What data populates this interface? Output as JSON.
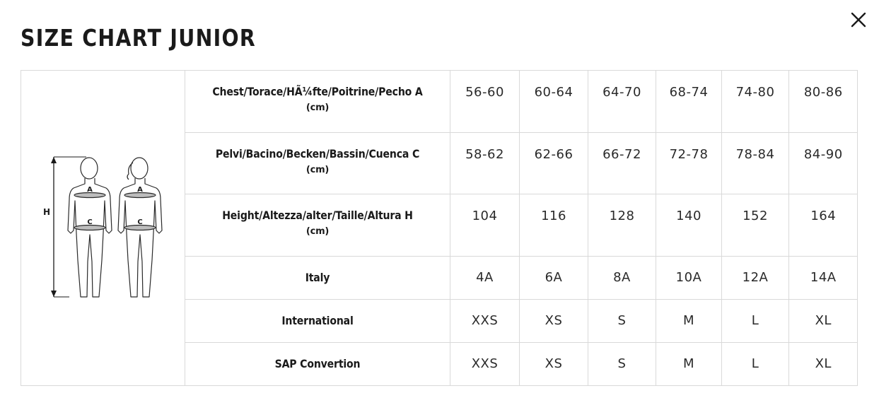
{
  "title": "SIZE CHART JUNIOR",
  "close_icon": "close-icon",
  "figure": {
    "height_label": "H",
    "chest_label": "A",
    "pelvis_label": "C"
  },
  "rows": [
    {
      "label": "Chest/Torace/HÃ¼fte/Poitrine/Pecho A",
      "unit": "(cm)",
      "values": [
        "56-60",
        "60-64",
        "64-70",
        "68-74",
        "74-80",
        "80-86"
      ]
    },
    {
      "label": "Pelvi/Bacino/Becken/Bassin/Cuenca C",
      "unit": "(cm)",
      "values": [
        "58-62",
        "62-66",
        "66-72",
        "72-78",
        "78-84",
        "84-90"
      ]
    },
    {
      "label": "Height/Altezza/alter/Taille/Altura H",
      "unit": "(cm)",
      "values": [
        "104",
        "116",
        "128",
        "140",
        "152",
        "164"
      ]
    },
    {
      "label": "Italy",
      "unit": "",
      "values": [
        "4A",
        "6A",
        "8A",
        "10A",
        "12A",
        "14A"
      ]
    },
    {
      "label": "International",
      "unit": "",
      "values": [
        "XXS",
        "XS",
        "S",
        "M",
        "L",
        "XL"
      ]
    },
    {
      "label": "SAP Convertion",
      "unit": "",
      "values": [
        "XXS",
        "XS",
        "S",
        "M",
        "L",
        "XL"
      ]
    }
  ]
}
